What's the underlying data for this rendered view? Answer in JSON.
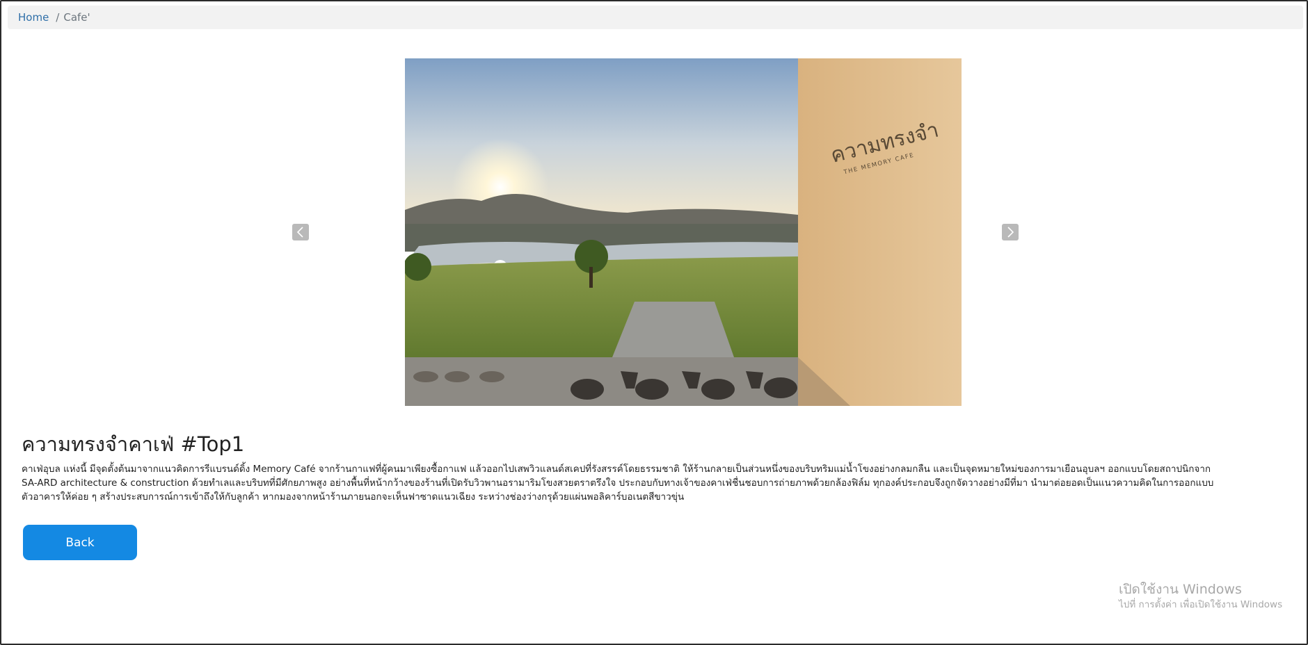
{
  "breadcrumb": {
    "home_label": "Home",
    "separator": "/",
    "current_label": "Cafe'"
  },
  "carousel": {
    "prev_icon": "chevron-left-icon",
    "next_icon": "chevron-right-icon",
    "slide": {
      "sign_text": "ความทรงจำ",
      "sign_sub": "THE MEMORY CAFE"
    }
  },
  "article": {
    "title": "ความทรงจำคาเฟ่ #Top1",
    "body": "คาเฟ่อุบล แห่งนี้ มีจุดตั้งต้นมาจากแนวคิดการรีแบรนด์ดิ้ง Memory Café จากร้านกาแฟที่ผู้คนมาเพียงซื้อกาแฟ แล้วออกไปเสพวิวแลนด์สเคปที่รังสรรค์โดยธรรมชาติ ให้ร้านกลายเป็นส่วนหนึ่งของบริบทริมแม่น้ำโขงอย่างกลมกลืน และเป็นจุดหมายใหม่ของการมาเยือนอุบลฯ ออกแบบโดยสถาปนิกจาก SA-ARD architecture & construction ด้วยทำเลและบริบทที่มีศักยภาพสูง อย่างพื้นที่หน้ากว้างของร้านที่เปิดรับวิวพานอรามาริมโขงสวยตราตรึงใจ ประกอบกับทางเจ้าของคาเฟ่ชื่นชอบการถ่ายภาพด้วยกล้องฟิล์ม ทุกองค์ประกอบจึงถูกจัดวางอย่างมีที่มา นำมาต่อยอดเป็นแนวความคิดในการออกแบบตัวอาคารให้ค่อย ๆ สร้างประสบการณ์การเข้าถึงให้กับลูกค้า หากมองจากหน้าร้านภายนอกจะเห็นฟาซาดแนวเฉียง ระหว่างช่องว่างกรุด้วยแผ่นพอลิคาร์บอเนตสีขาวขุ่น"
  },
  "actions": {
    "back_label": "Back"
  },
  "watermark": {
    "title": "เปิดใช้งาน Windows",
    "subtitle": "ไปที่ การตั้งค่า เพื่อเปิดใช้งาน Windows"
  },
  "colors": {
    "link": "#2f6fa8",
    "button": "#1489e3",
    "wall": "#dfb987"
  }
}
